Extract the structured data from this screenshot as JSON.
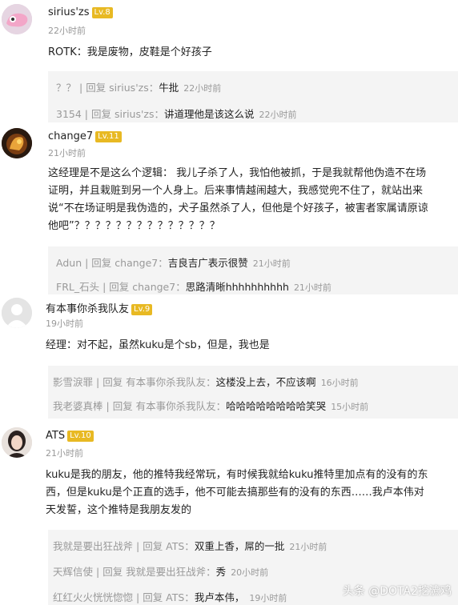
{
  "comments": [
    {
      "user": "sirius'zs",
      "level": "Lv.8",
      "time": "22小时前",
      "text": "ROTK：我是废物，皮鞋是个好孩子",
      "replies": [
        {
          "author": "？？",
          "label": "回复 sirius'zs：",
          "content": "牛批",
          "time": "22小时前"
        },
        {
          "author": "3154",
          "label": "回复 sirius'zs：",
          "content": "讲道理他是该这么说",
          "time": "22小时前"
        }
      ]
    },
    {
      "user": "change7",
      "level": "Lv.11",
      "time": "21小时前",
      "text_lines": [
        "这经理是不是这么个逻辑： 我儿子杀了人，我怕他被抓，于是我就帮他伪造不在场",
        "证明，并且栽赃到另一个人身上。后来事情越闹越大，我感觉兜不住了，就站出来",
        "说“不在场证明是我伪造的，犬子虽然杀了人，但他是个好孩子，被害者家属请原谅",
        "他吧”？？？？？？？？？？？？？？"
      ],
      "replies": [
        {
          "author": "Adun",
          "label": "回复 change7：",
          "content": "吉良吉广表示很赞",
          "time": "21小时前"
        },
        {
          "author": "FRL_石头",
          "label": "回复 change7：",
          "content": "思路清晰hhhhhhhhhh",
          "time": "21小时前"
        }
      ]
    },
    {
      "user": "有本事你杀我队友",
      "level": "Lv.9",
      "time": "19小时前",
      "text": "经理：对不起，虽然kuku是个sb，但是，我也是",
      "replies": [
        {
          "author": "影雪淚罪",
          "label": "回复 有本事你杀我队友：",
          "content": "这楼没上去，不应该啊",
          "time": "16小时前"
        },
        {
          "author": "我老婆真棒",
          "label": "回复 有本事你杀我队友：",
          "content": "哈哈哈哈哈哈哈哈笑哭",
          "time": "15小时前"
        }
      ]
    },
    {
      "user": "ATS",
      "level": "Lv.10",
      "time": "21小时前",
      "text_lines": [
        "kuku是我的朋友，他的推特我经常玩，有时候我就给kuku推特里加点有的没有的东",
        "西，但是kuku是个正直的选手，他不可能去搞那些有的没有的东西……我卢本伟对",
        "天发誓，这个推特是我朋友发的"
      ],
      "replies": [
        {
          "author": "我就是要出狂战斧",
          "label": "回复 ATS：",
          "content": "双重上香，屌的一批",
          "time": "21小时前"
        },
        {
          "author": "天辉信使",
          "label": "回复 我就是要出狂战斧：",
          "content": "秀",
          "time": "20小时前"
        },
        {
          "author": "红红火火恍恍惚惚",
          "label": "回复 ATS：",
          "content": "我卢本伟，",
          "time": "19小时前"
        }
      ]
    }
  ],
  "watermark": "头条 @DOTA2挖瀌鸡"
}
